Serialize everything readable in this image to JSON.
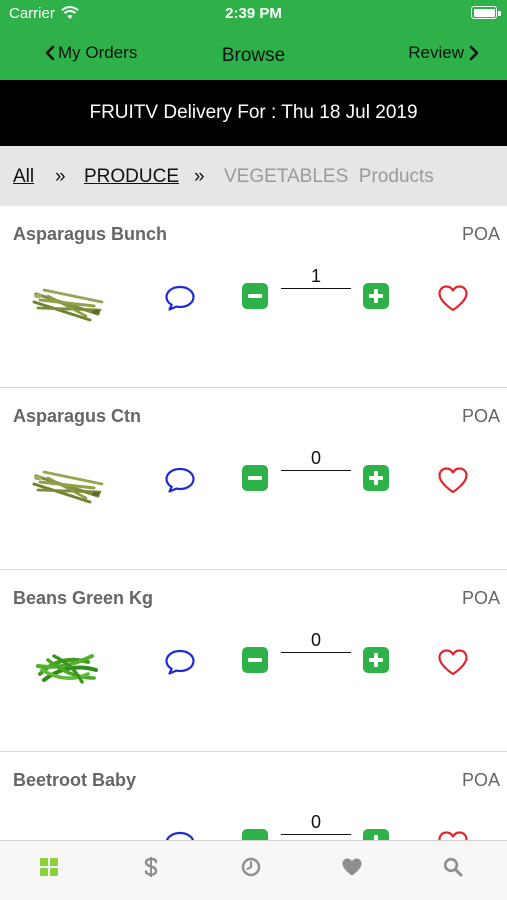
{
  "status_bar": {
    "carrier": "Carrier",
    "time": "2:39 PM"
  },
  "nav": {
    "back_label": "My Orders",
    "title": "Browse",
    "forward_label": "Review"
  },
  "delivery_banner": "FRUITV Delivery For : Thu 18 Jul 2019",
  "breadcrumb": {
    "all": "All",
    "sep1": "»",
    "produce": "PRODUCE",
    "sep2": "»",
    "current": "VEGETABLES  Products"
  },
  "products": [
    {
      "name": "Asparagus Bunch",
      "price": "POA",
      "quantity": "1",
      "image_icon": "asparagus-image"
    },
    {
      "name": "Asparagus Ctn",
      "price": "POA",
      "quantity": "0",
      "image_icon": "asparagus-image"
    },
    {
      "name": "Beans Green Kg",
      "price": "POA",
      "quantity": "0",
      "image_icon": "green-beans-image"
    },
    {
      "name": "Beetroot Baby",
      "price": "POA",
      "quantity": "0",
      "image_icon": "beetroot-image"
    }
  ],
  "tabs": [
    {
      "icon": "grid-icon",
      "active": true
    },
    {
      "icon": "dollar-icon",
      "active": false
    },
    {
      "icon": "clock-icon",
      "active": false
    },
    {
      "icon": "heart-icon",
      "active": false
    },
    {
      "icon": "search-icon",
      "active": false
    }
  ],
  "colors": {
    "brand_green": "#2fb14a",
    "active_tab": "#8bd13c",
    "inactive_tab": "#8e8e8e",
    "comment_blue": "#1a2bd6",
    "heart_red": "#e0252b",
    "banner_black": "#000000"
  }
}
